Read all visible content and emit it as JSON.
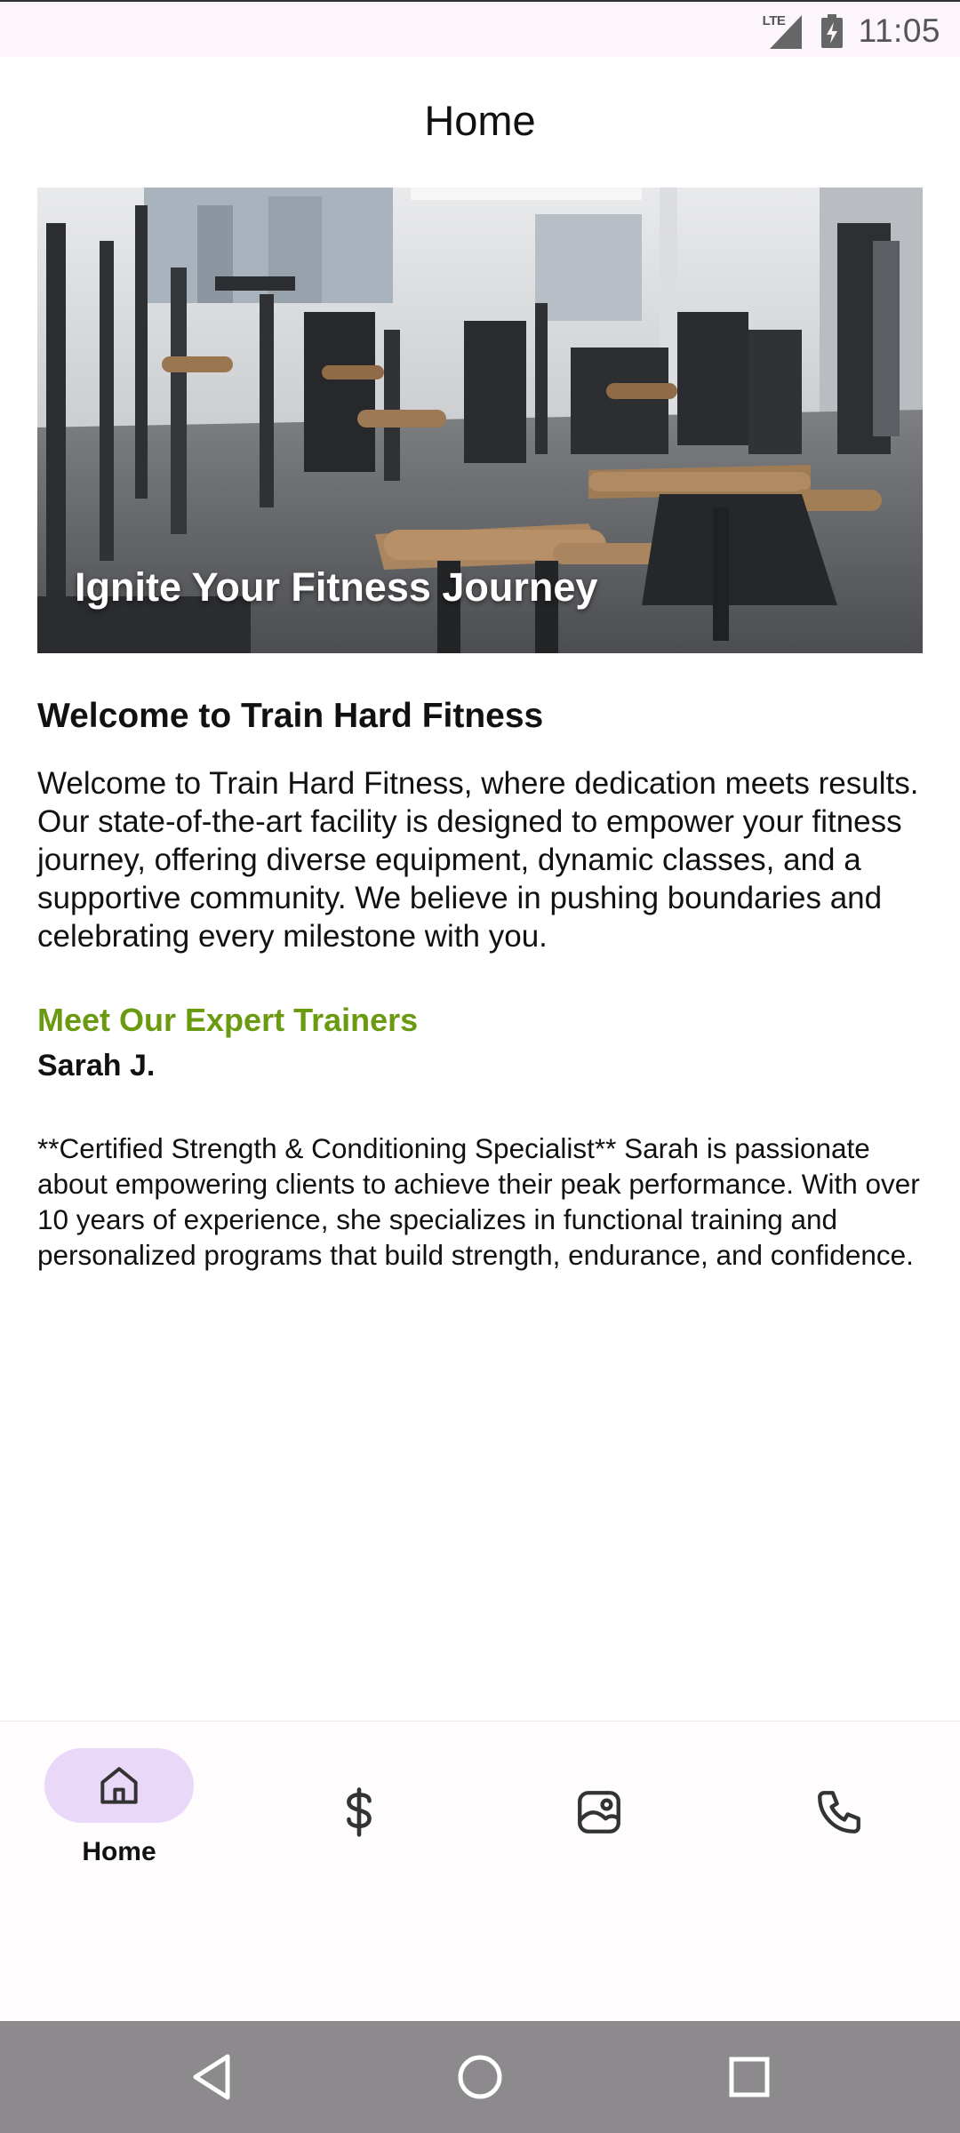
{
  "status_bar": {
    "network": "LTE",
    "time": "11:05"
  },
  "app_bar": {
    "title": "Home"
  },
  "hero": {
    "caption": "Ignite Your Fitness Journey"
  },
  "welcome": {
    "heading": "Welcome to Train Hard Fitness",
    "body": "Welcome to Train Hard Fitness, where dedication meets results. Our state-of-the-art facility is designed to empower your fitness journey, offering diverse equipment, dynamic classes, and a supportive community. We believe in pushing boundaries and celebrating every milestone with you."
  },
  "trainers": {
    "heading": "Meet Our Expert Trainers",
    "items": [
      {
        "name": "Sarah J.",
        "bio": "**Certified Strength & Conditioning Specialist** Sarah is passionate about empowering clients to achieve their peak performance. With over 10 years of experience, she specializes in functional training and personalized programs that build strength, endurance, and confidence."
      }
    ]
  },
  "bottom_nav": {
    "items": [
      {
        "label": "Home",
        "icon": "home-icon",
        "active": true
      },
      {
        "label": "",
        "icon": "dollar-icon",
        "active": false
      },
      {
        "label": "",
        "icon": "image-icon",
        "active": false
      },
      {
        "label": "",
        "icon": "phone-icon",
        "active": false
      }
    ]
  },
  "colors": {
    "accent_green": "#6a9a0f",
    "nav_active_pill": "#ead8f8",
    "status_bar_bg": "#fdf5fc",
    "system_nav_bg": "#8d8a8e"
  }
}
